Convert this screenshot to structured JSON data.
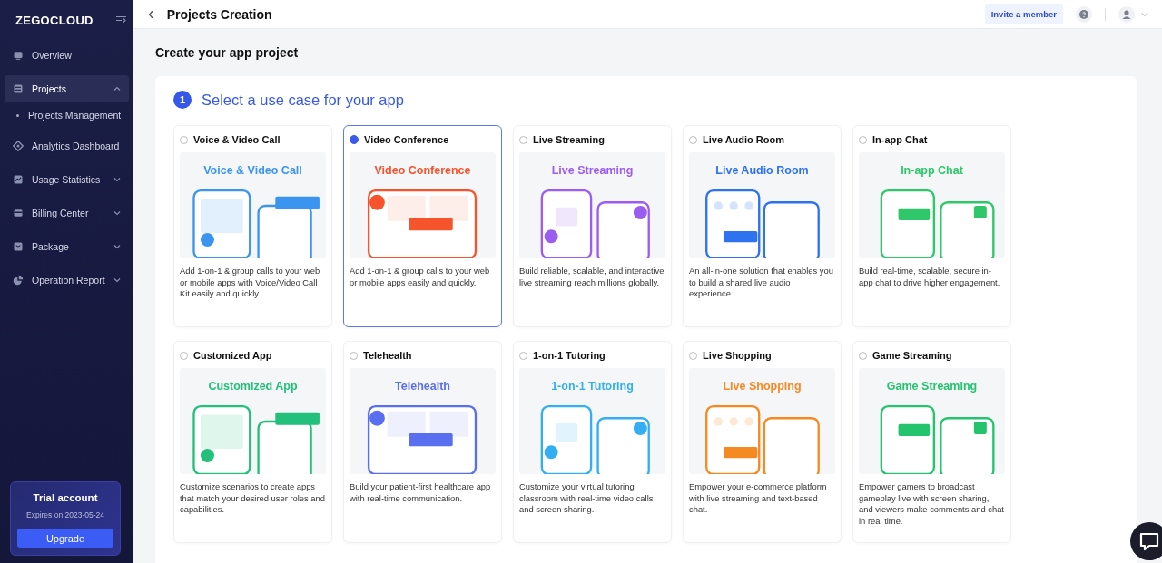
{
  "sidebar": {
    "logo": "ZEGOCLOUD",
    "items": [
      {
        "label": "Overview",
        "kind": "link",
        "selected": false
      },
      {
        "label": "Projects",
        "kind": "group",
        "selected": true,
        "expanded": true,
        "children": [
          {
            "label": "Projects Management",
            "selected": false
          }
        ]
      },
      {
        "label": "Analytics Dashboard",
        "kind": "link",
        "selected": false
      },
      {
        "label": "Usage Statistics",
        "kind": "group",
        "selected": false,
        "expanded": false
      },
      {
        "label": "Billing Center",
        "kind": "group",
        "selected": false,
        "expanded": false
      },
      {
        "label": "Package",
        "kind": "group",
        "selected": false,
        "expanded": false
      },
      {
        "label": "Operation Report",
        "kind": "group",
        "selected": false,
        "expanded": false
      }
    ],
    "trial": {
      "title": "Trial account",
      "expires": "Expires on 2023-05-24",
      "button": "Upgrade"
    }
  },
  "topbar": {
    "back": "‹",
    "title": "Projects Creation",
    "invite_button": "Invite a member"
  },
  "heading": "Create your app project",
  "step": {
    "number": "1",
    "title": "Select a use case for your app"
  },
  "use_cases": [
    {
      "title": "Voice & Video Call",
      "selected": false,
      "illustration_title": "Voice & Video Call",
      "color": "#3b95f0",
      "description": "Add 1-on-1 & group calls to your web or mobile apps with Voice/Video Call Kit easily and quickly."
    },
    {
      "title": "Video Conference",
      "selected": true,
      "illustration_title": "Video Conference",
      "color": "#f5542d",
      "description": "Add 1-on-1 & group calls to your web or mobile apps easily and quickly."
    },
    {
      "title": "Live Streaming",
      "selected": false,
      "illustration_title": "Live Streaming",
      "color": "#9b5cf2",
      "description": "Build reliable, scalable, and interactive live streaming reach millions globally."
    },
    {
      "title": "Live Audio Room",
      "selected": false,
      "illustration_title": "Live Audio Room",
      "color": "#2f72f0",
      "description": "An all-in-one solution that enables you to build a shared live audio experience."
    },
    {
      "title": "In-app Chat",
      "selected": false,
      "illustration_title": "In-app Chat",
      "color": "#2fc76a",
      "description": "Build real-time, scalable, secure in-app chat to drive higher engagement."
    },
    {
      "title": "Customized App",
      "selected": false,
      "illustration_title": "Customized App",
      "color": "#22c07a",
      "description": "Customize scenarios to create apps that match your desired user roles and capabilities."
    },
    {
      "title": "Telehealth",
      "selected": false,
      "illustration_title": "Telehealth",
      "color": "#5a6ff0",
      "description": "Build your patient-first healthcare app with real-time communication."
    },
    {
      "title": "1-on-1 Tutoring",
      "selected": false,
      "illustration_title": "1-on-1 Tutoring",
      "color": "#33aef2",
      "description": "Customize your virtual tutoring classroom with real-time video calls and screen sharing."
    },
    {
      "title": "Live Shopping",
      "selected": false,
      "illustration_title": "Live Shopping",
      "color": "#f58a23",
      "description": "Empower your e-commerce platform with live streaming and text-based chat."
    },
    {
      "title": "Game Streaming",
      "selected": false,
      "illustration_title": "Game Streaming",
      "color": "#24c46e",
      "description": "Empower gamers to broadcast gameplay live with screen sharing, and viewers make comments and chat in real time."
    }
  ]
}
